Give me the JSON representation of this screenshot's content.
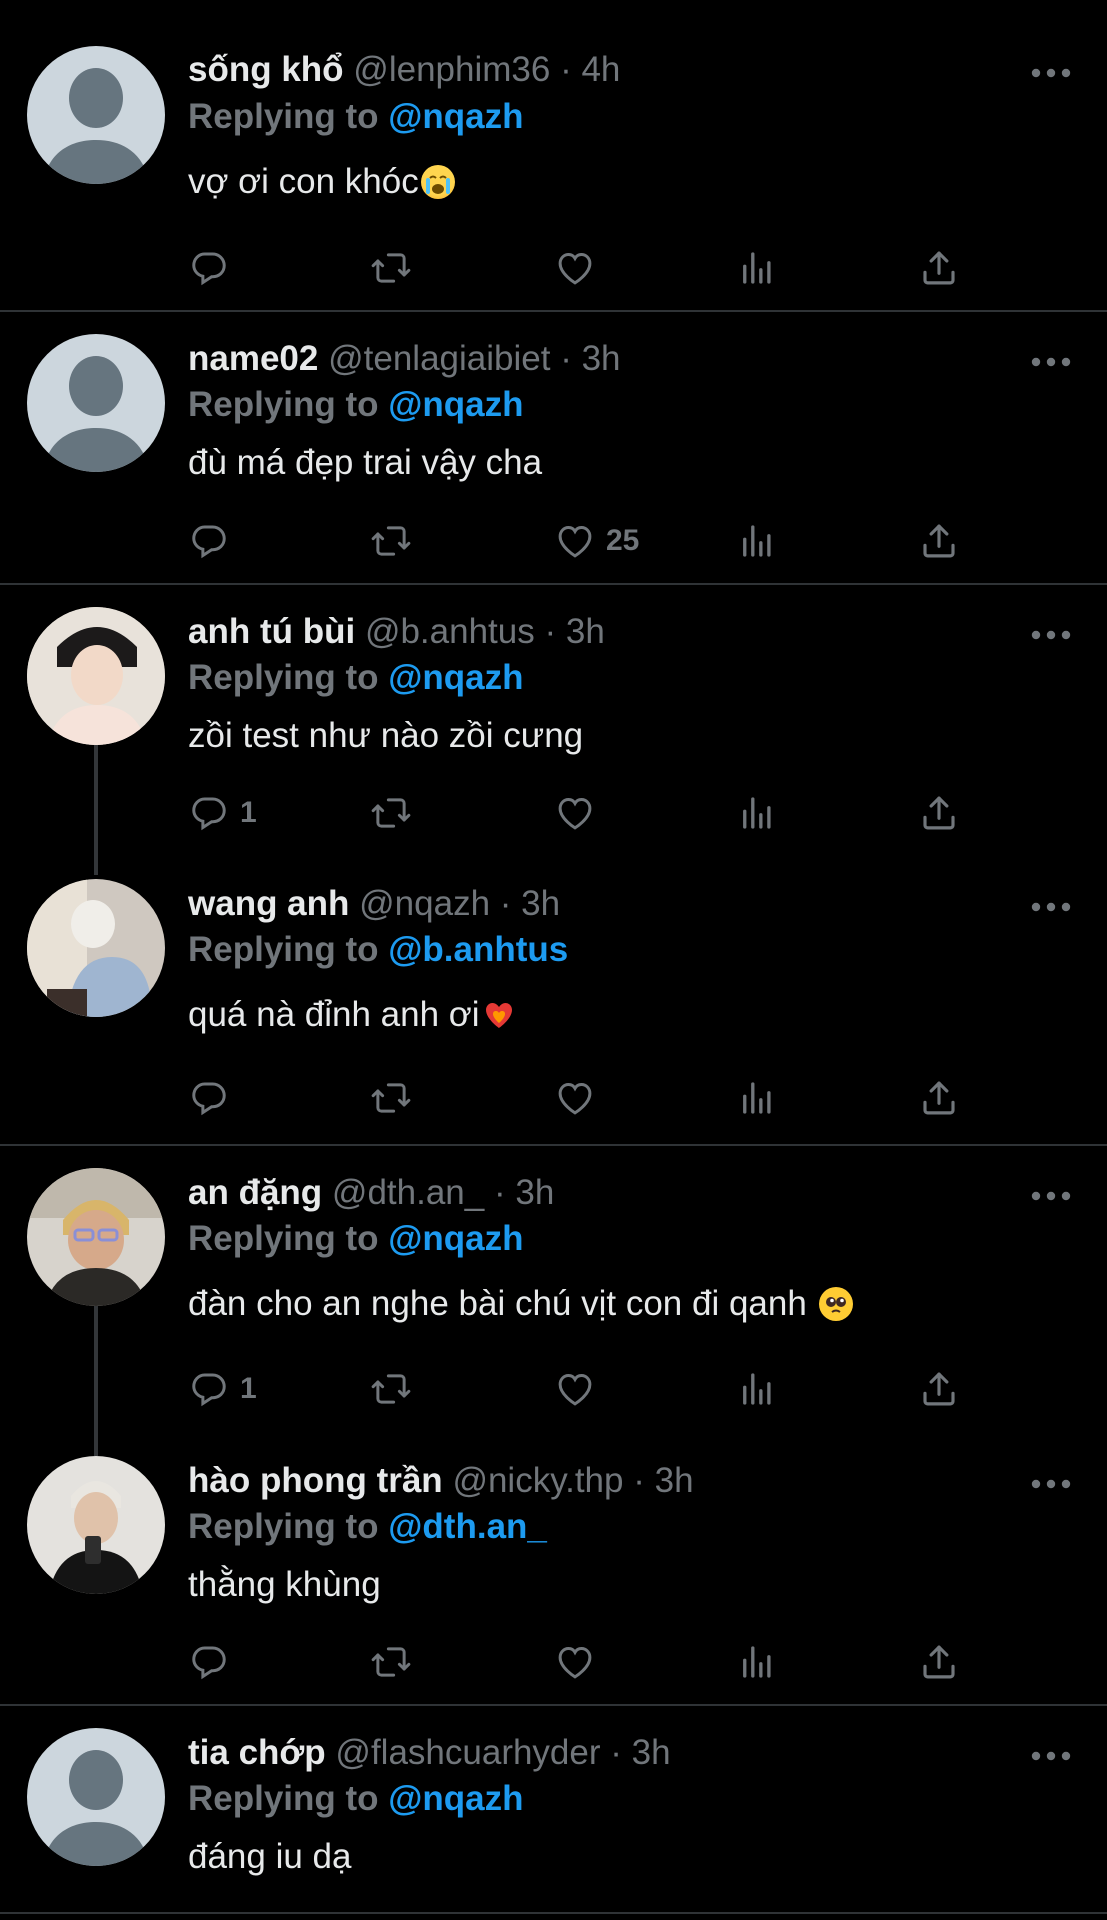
{
  "tweets": [
    {
      "name": "sống khổ",
      "handle": "@lenphim36",
      "time": "4h",
      "replying_label": "Replying to",
      "replying_to": "@nqazh",
      "text": "vợ ơi con khóc",
      "emoji": "loudly-crying-face",
      "avatar": "default-avatar",
      "counts": {
        "reply": "",
        "like": ""
      }
    },
    {
      "name": "name02",
      "handle": "@tenlagiaibiet",
      "time": "3h",
      "replying_label": "Replying to",
      "replying_to": "@nqazh",
      "text": "đù má đẹp trai vậy cha",
      "avatar": "default-avatar",
      "counts": {
        "reply": "",
        "like": "25"
      }
    },
    {
      "name": "anh tú bùi",
      "handle": "@b.anhtus",
      "time": "3h",
      "replying_label": "Replying to",
      "replying_to": "@nqazh",
      "text": "zồi test như nào zồi cưng",
      "avatar": "photo-avatar",
      "counts": {
        "reply": "1",
        "like": ""
      }
    },
    {
      "name": "wang anh",
      "handle": "@nqazh",
      "time": "3h",
      "replying_label": "Replying to",
      "replying_to": "@b.anhtus",
      "text": "quá nà đỉnh anh ơi",
      "emoji": "heart-on-fire",
      "avatar": "photo-avatar",
      "counts": {
        "reply": "",
        "like": ""
      }
    },
    {
      "name": "an đặng",
      "handle": "@dth.an_",
      "time": "3h",
      "replying_label": "Replying to",
      "replying_to": "@nqazh",
      "text": "đàn cho an nghe bài chú vịt con đi qanh ",
      "emoji": "pleading-face",
      "avatar": "photo-avatar",
      "counts": {
        "reply": "1",
        "like": ""
      }
    },
    {
      "name": "hào phong trần",
      "handle": "@nicky.thp",
      "time": "3h",
      "replying_label": "Replying to",
      "replying_to": "@dth.an_",
      "text": "thằng khùng",
      "avatar": "photo-avatar",
      "counts": {
        "reply": "",
        "like": ""
      }
    },
    {
      "name": "tia chớp",
      "handle": "@flashcuarhyder",
      "time": "3h",
      "replying_label": "Replying to",
      "replying_to": "@nqazh",
      "text": "đáng iu dạ",
      "avatar": "default-avatar",
      "counts": {
        "reply": "",
        "like": ""
      }
    }
  ],
  "separator": "·",
  "colors": {
    "background": "#000000",
    "text": "#e7e9ea",
    "secondary": "#71767b",
    "accent": "#1d9bf0",
    "divider": "#2f3336"
  },
  "icons": [
    "reply-icon",
    "retweet-icon",
    "like-icon",
    "views-icon",
    "share-icon",
    "more-icon"
  ]
}
